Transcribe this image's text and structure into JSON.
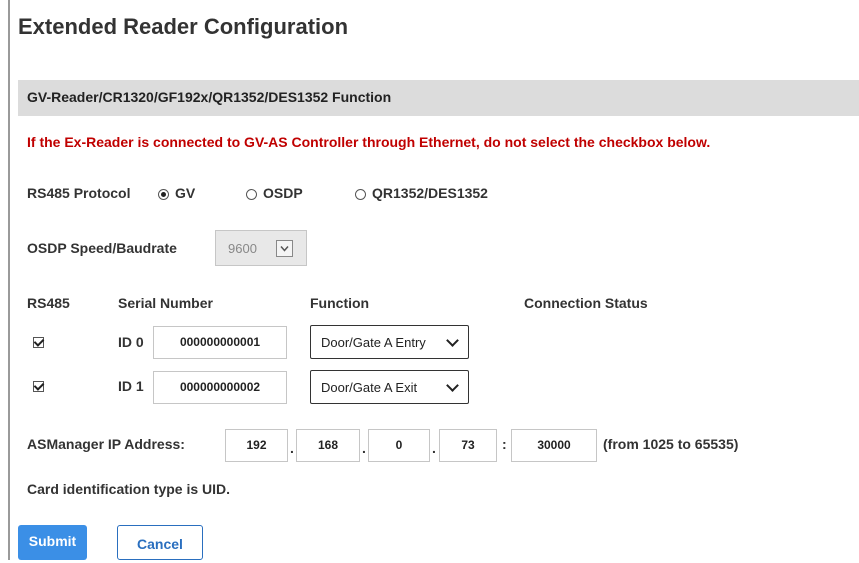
{
  "page": {
    "title": "Extended Reader Configuration",
    "section_title": "GV-Reader/CR1320/GF192x/QR1352/DES1352 Function",
    "warning": "If the Ex-Reader is connected to GV-AS Controller through Ethernet, do not select the checkbox below."
  },
  "protocol": {
    "label": "RS485 Protocol",
    "options": [
      {
        "label": "GV",
        "selected": true
      },
      {
        "label": "OSDP",
        "selected": false
      },
      {
        "label": "QR1352/DES1352",
        "selected": false
      }
    ]
  },
  "osdp": {
    "label": "OSDP Speed/Baudrate",
    "value": "9600"
  },
  "table": {
    "headers": [
      "RS485",
      "Serial Number",
      "Function",
      "Connection Status"
    ],
    "rows": [
      {
        "checked": true,
        "id": "ID 0",
        "serial": "000000000001",
        "function": "Door/Gate A Entry",
        "status": ""
      },
      {
        "checked": true,
        "id": "ID 1",
        "serial": "000000000002",
        "function": "Door/Gate A Exit",
        "status": ""
      }
    ]
  },
  "ip": {
    "label": "ASManager IP Address:",
    "octets": [
      "192",
      "168",
      "0",
      "73"
    ],
    "dot": ".",
    "colon": ":",
    "port": "30000",
    "range": "(from 1025 to 65535)"
  },
  "card_info": "Card identification type is UID.",
  "buttons": {
    "submit": "Submit",
    "cancel": "Cancel"
  }
}
